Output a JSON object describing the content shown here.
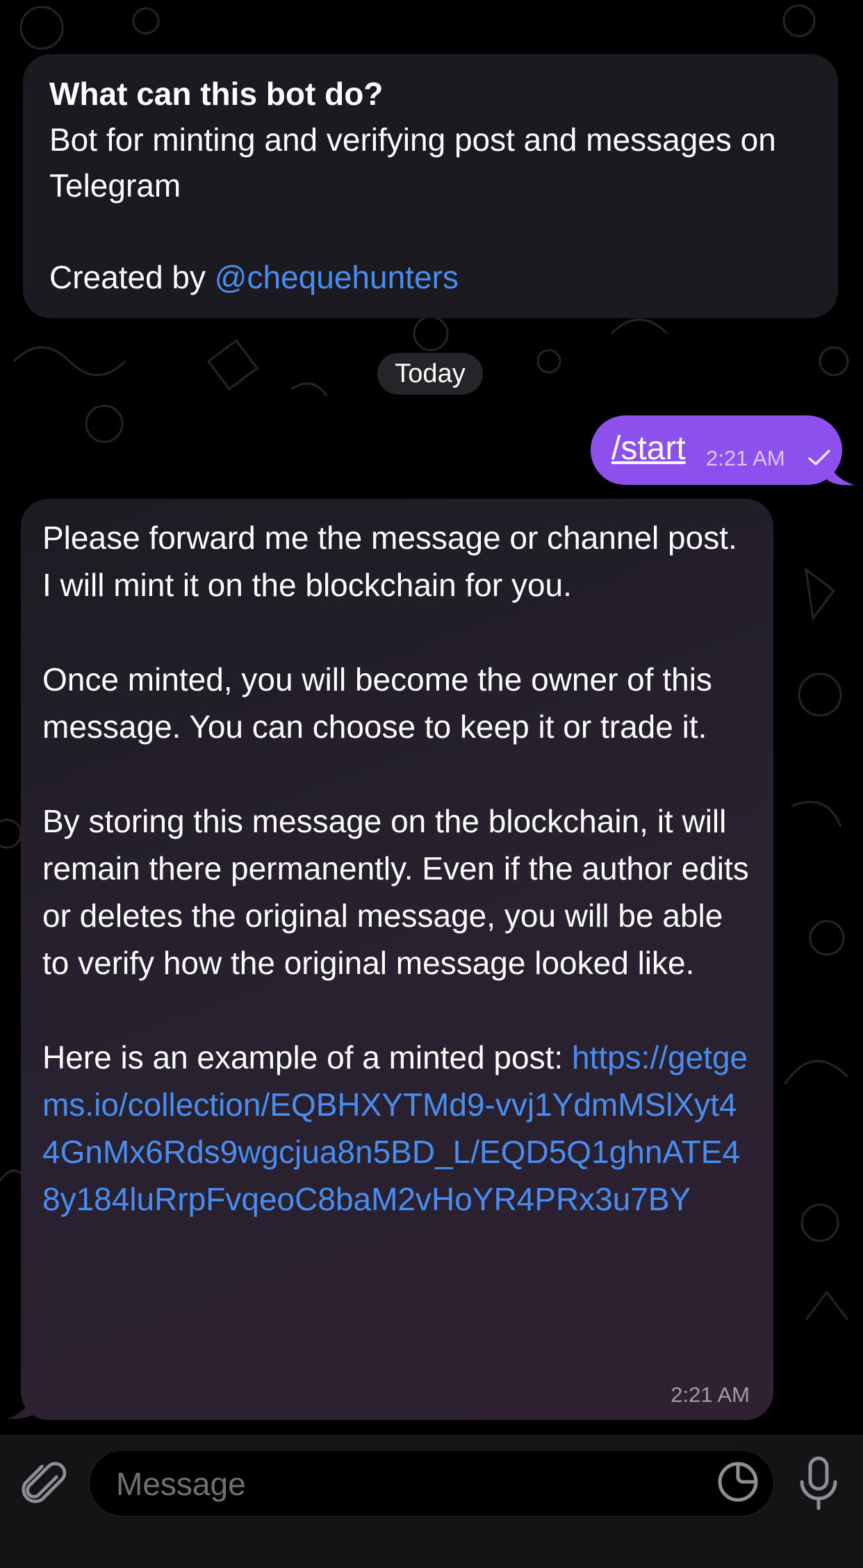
{
  "bot_info": {
    "title": "What can this bot do?",
    "description": "Bot for minting and verifying post and messages on Telegram\n\nCreated by ",
    "creator_link": "@chequehunters"
  },
  "date_separator": "Today",
  "outgoing_message": {
    "text": "/start",
    "time": "2:21 AM",
    "status_icon": "single-check-icon"
  },
  "incoming_message": {
    "text": "Please forward me the message or channel post. I will mint it on the blockchain for you.\n\nOnce minted, you will become the owner of this message. You can choose to keep it or trade it.\n\nBy storing this message on the blockchain, it will remain there permanently. Even if the author edits or deletes the original message, you will be able to verify how the original message looked like.\n\nHere is an example of a minted post: ",
    "link": "https://getgems.io/collection/EQBHXYTMd9-vvj1YdmMSlXyt44GnMx6Rds9wgcjua8n5BD_L/EQD5Q1ghnATE48y184luRrpFvqeoC8baM2vHoYR4PRx3u7BY",
    "time": "2:21 AM"
  },
  "composer": {
    "placeholder": "Message",
    "icons": [
      "paperclip-icon",
      "sticker-icon",
      "microphone-icon"
    ]
  },
  "colors": {
    "accent_purple": "#8c50ec",
    "link_blue": "#4a8df2",
    "bubble_dark": "#1c1b21"
  }
}
